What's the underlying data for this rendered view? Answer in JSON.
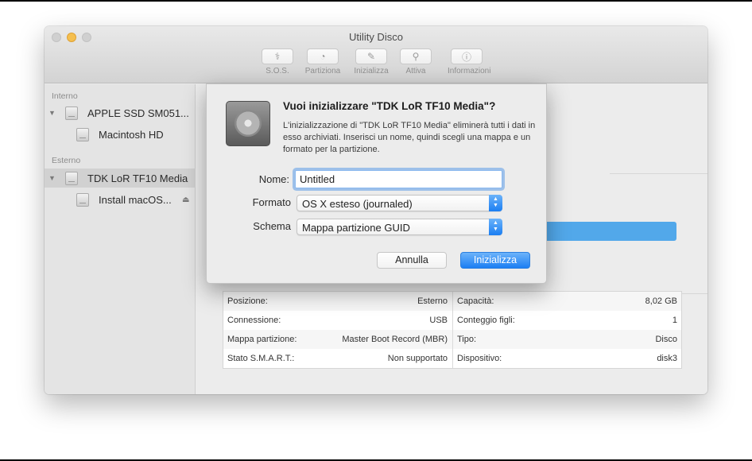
{
  "window": {
    "title": "Utility Disco"
  },
  "toolbar": [
    {
      "label": "S.O.S.",
      "icon": "stethoscope-icon",
      "glyph": "⚕"
    },
    {
      "label": "Partiziona",
      "icon": "partition-icon",
      "glyph": "◔"
    },
    {
      "label": "Inizializza",
      "icon": "erase-icon",
      "glyph": "✎"
    },
    {
      "label": "Attiva",
      "icon": "mount-icon",
      "glyph": "⚲"
    },
    {
      "label": "Informazioni",
      "icon": "info-icon",
      "glyph": "ⓘ"
    }
  ],
  "sidebar": {
    "section_internal": "Interno",
    "section_external": "Esterno",
    "items": [
      {
        "label": "APPLE SSD SM051...",
        "expanded": true
      },
      {
        "label": "Macintosh HD"
      },
      {
        "label": "TDK LoR TF10 Media",
        "selected": true,
        "expanded": true
      },
      {
        "label": "Install macOS...",
        "eject": "⏏"
      }
    ]
  },
  "info": {
    "rows": [
      {
        "l1": "Posizione:",
        "v1": "Esterno",
        "l2": "Capacità:",
        "v2": "8,02 GB"
      },
      {
        "l1": "Connessione:",
        "v1": "USB",
        "l2": "Conteggio figli:",
        "v2": "1"
      },
      {
        "l1": "Mappa partizione:",
        "v1": "Master Boot Record (MBR)",
        "l2": "Tipo:",
        "v2": "Disco"
      },
      {
        "l1": "Stato S.M.A.R.T.:",
        "v1": "Non supportato",
        "l2": "Dispositivo:",
        "v2": "disk3"
      }
    ]
  },
  "dialog": {
    "title": "Vuoi inizializzare \"TDK LoR TF10 Media\"?",
    "message": "L'inizializzazione di \"TDK LoR TF10 Media\" eliminerà tutti i dati in esso archiviati. Inserisci un nome, quindi scegli una mappa e un formato per la partizione.",
    "name_label": "Nome:",
    "name_value": "Untitled",
    "format_label": "Formato",
    "format_value": "OS X esteso (journaled)",
    "scheme_label": "Schema",
    "scheme_value": "Mappa partizione GUID",
    "cancel_label": "Annulla",
    "confirm_label": "Inizializza"
  },
  "colors": {
    "accent": "#1c7ef3",
    "selection": "#d1d1d1",
    "progress": "#52a8ea"
  }
}
